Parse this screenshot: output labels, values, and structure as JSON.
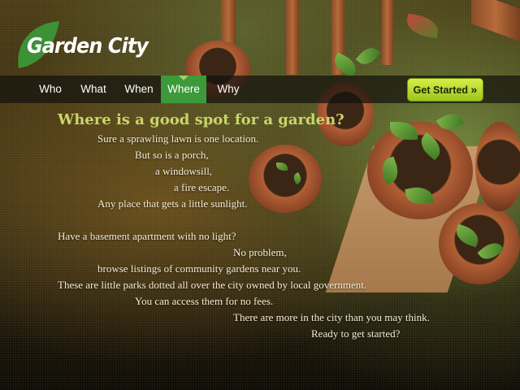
{
  "brand": {
    "name": "Garden City",
    "logo_icon": "leaf-logo-icon"
  },
  "nav": {
    "items": [
      {
        "label": "Who"
      },
      {
        "label": "What"
      },
      {
        "label": "When"
      },
      {
        "label": "Where",
        "active": true
      },
      {
        "label": "Why"
      }
    ],
    "cta_label": "Get Started",
    "cta_icon": "double-chevron-right"
  },
  "content": {
    "headline": "Where is a good spot for a garden?",
    "lines": [
      "Sure a sprawling lawn is one location.",
      "But so is a porch,",
      "a windowsill,",
      "a fire escape.",
      "Any place that gets a little sunlight.",
      "Have a basement apartment with no light?",
      "No problem,",
      "browse listings of community gardens near you.",
      "These are little parks dotted all over the city owned by local government.",
      "You can access them for no fees.",
      "There are more in the city than you may think.",
      "Ready to get started?"
    ]
  },
  "colors": {
    "accent_green": "#3c9a3a",
    "cta": "#c3e03a",
    "headline": "#c9d66a"
  }
}
